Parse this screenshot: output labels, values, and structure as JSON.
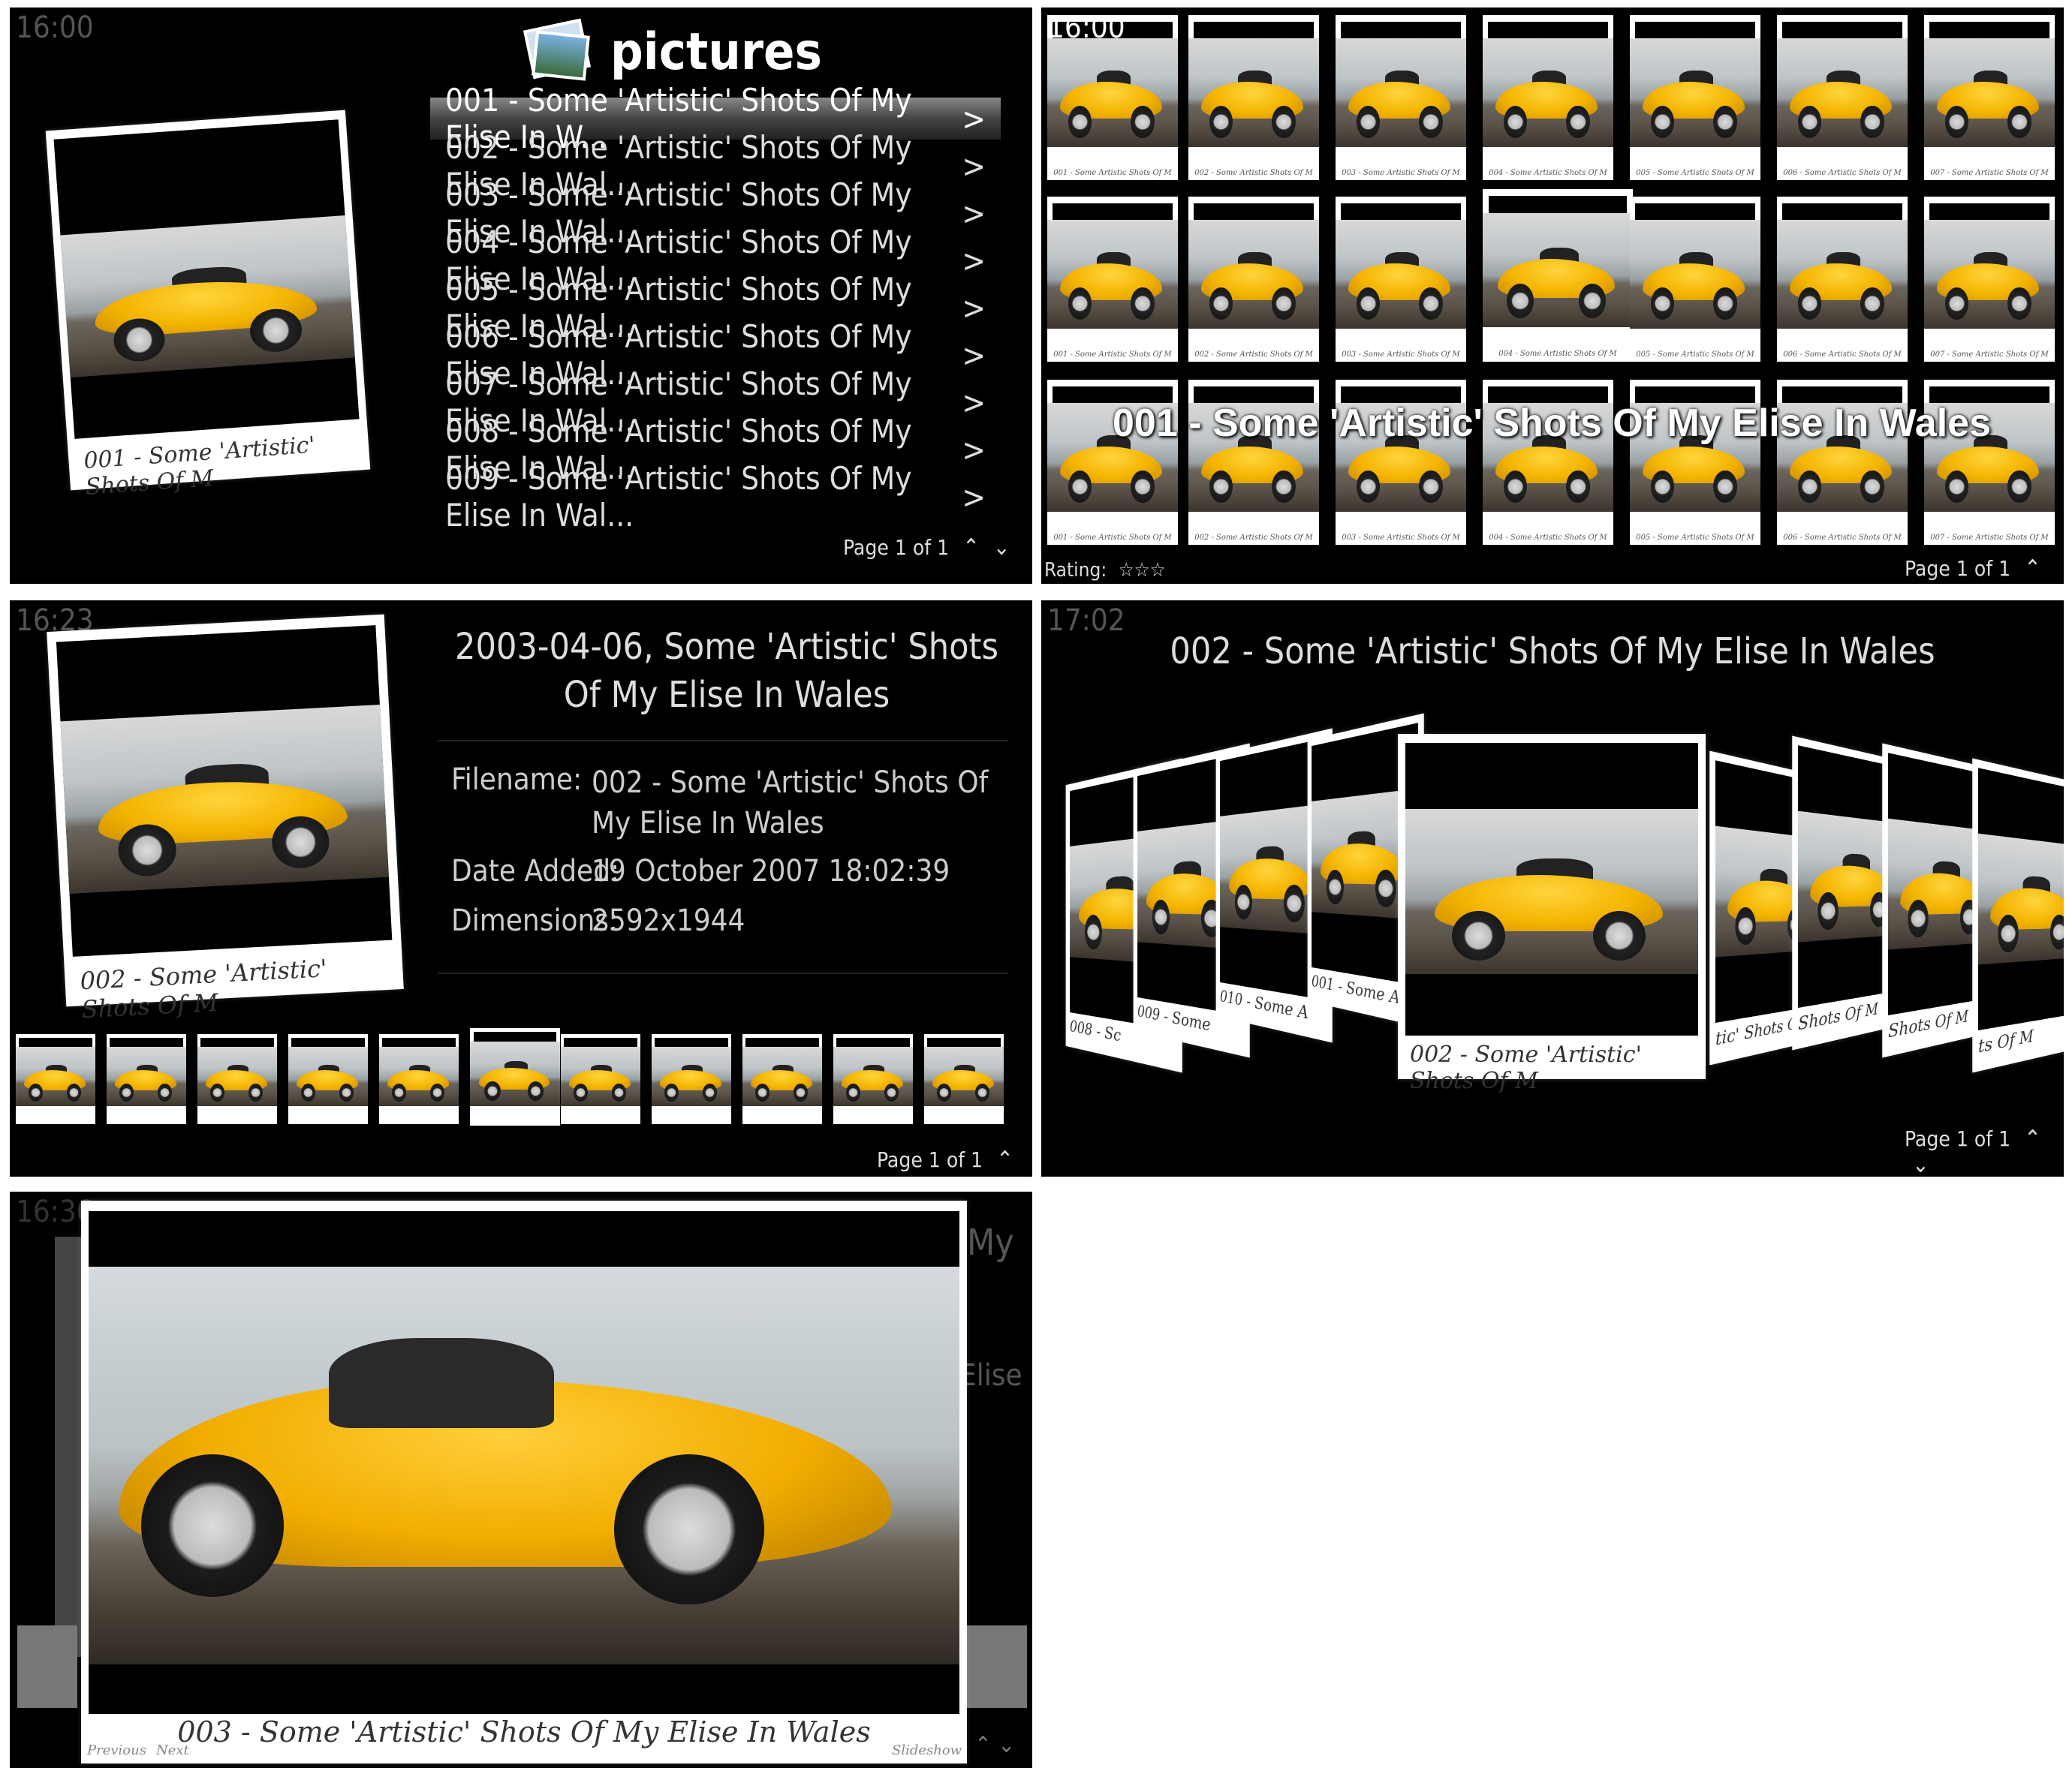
{
  "panel1": {
    "clock": "16:00",
    "title": "pictures",
    "selected_caption": "001 - Some 'Artistic' Shots Of M",
    "items": [
      {
        "label": "001 - Some 'Artistic' Shots Of My Elise In W...",
        "chevron": ">"
      },
      {
        "label": "002 - Some 'Artistic' Shots Of My Elise In Wal...",
        "chevron": ">"
      },
      {
        "label": "003 - Some 'Artistic' Shots Of My Elise In Wal...",
        "chevron": ">"
      },
      {
        "label": "004 - Some 'Artistic' Shots Of My Elise In Wal...",
        "chevron": ">"
      },
      {
        "label": "005 - Some 'Artistic' Shots Of My Elise In Wal...",
        "chevron": ">"
      },
      {
        "label": "006 - Some 'Artistic' Shots Of My Elise In Wal...",
        "chevron": ">"
      },
      {
        "label": "007 - Some 'Artistic' Shots Of My Elise In Wal...",
        "chevron": ">"
      },
      {
        "label": "008 - Some 'Artistic' Shots Of My Elise In Wal...",
        "chevron": ">"
      },
      {
        "label": "009 - Some 'Artistic' Shots Of My Elise In Wal...",
        "chevron": ">"
      }
    ],
    "pager": "Page 1 of 1"
  },
  "panel2": {
    "clock": "16:00",
    "overlay_title": "001 - Some 'Artistic' Shots Of My Elise In Wales",
    "rating_label": "Rating:",
    "rating_stars": "☆☆☆",
    "pager": "Page 1 of 1",
    "thumb_captions": [
      "001 - Some Artistic Shots Of M",
      "002 - Some Artistic Shots Of M",
      "003 - Some Artistic Shots Of M",
      "004 - Some Artistic Shots Of M",
      "005 - Some Artistic Shots Of M",
      "006 - Some Artistic Shots Of M",
      "007 - Some Artistic Shots Of M"
    ]
  },
  "panel3": {
    "clock": "16:23",
    "heading": "2003-04-06, Some 'Artistic' Shots Of My Elise In Wales",
    "filename_label": "Filename:",
    "filename_value": "002 - Some 'Artistic' Shots Of My Elise In Wales",
    "date_label": "Date Added:",
    "date_value": "19 October 2007 18:02:39",
    "dims_label": "Dimensions:",
    "dims_value": "2592x1944",
    "photo_caption": "002 - Some 'Artistic' Shots Of M",
    "pager": "Page 1 of 1"
  },
  "panel4": {
    "clock": "17:02",
    "heading": "002 - Some 'Artistic' Shots Of My Elise In Wales",
    "center_caption": "002 - Some 'Artistic' Shots Of M",
    "pager": "Page 1 of 1",
    "side_captions": [
      "008 - Sc",
      "009 - Some",
      "010 - Some A",
      "001 - Some Arti",
      "tic' Shots Of M",
      "Shots Of M",
      "Shots Of M",
      "ts Of M"
    ]
  },
  "panel5": {
    "clock": "16:36",
    "bg_text_top": "My",
    "bg_text_mid": "Elise",
    "caption": "003 - Some 'Artistic' Shots Of My Elise In Wales",
    "prev_label": "Previous",
    "next_label": "Next",
    "slideshow_label": "Slideshow"
  },
  "icons": {
    "up": "⌃",
    "down": "⌄"
  }
}
